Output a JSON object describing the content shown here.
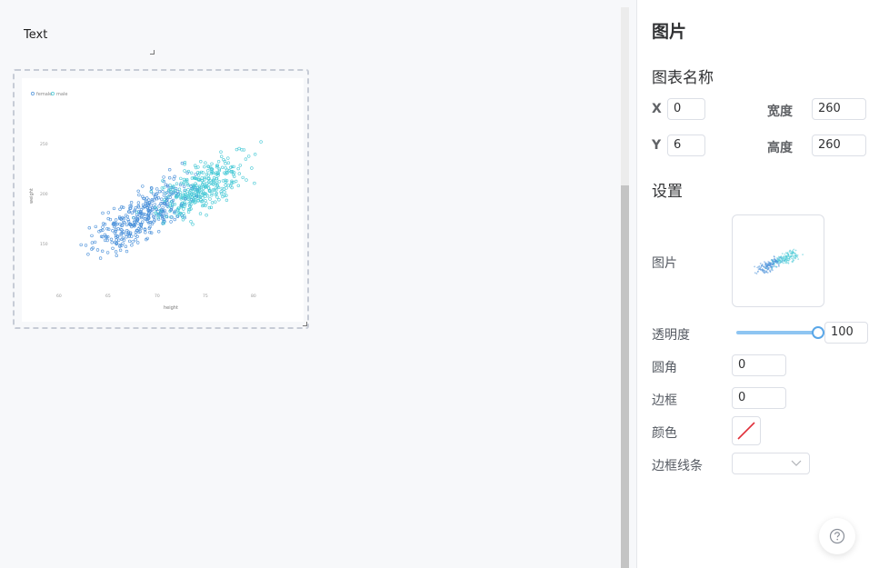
{
  "canvas": {
    "text_widget": "Text",
    "image_widget": {
      "legend": [
        "female",
        "male"
      ],
      "x_ticks": [
        "60",
        "65",
        "70",
        "75",
        "80"
      ],
      "y_ticks": [
        "150",
        "200",
        "250"
      ],
      "xlabel": "height",
      "ylabel": "weight"
    }
  },
  "panel": {
    "title": "图片",
    "section_chart_name": "图表名称",
    "x_label": "X",
    "x_value": "0",
    "width_label": "宽度",
    "width_value": "260",
    "y_label": "Y",
    "y_value": "6",
    "height_label": "高度",
    "height_value": "260",
    "section_settings": "设置",
    "image_label": "图片",
    "opacity_label": "透明度",
    "opacity_value": "100",
    "radius_label": "圆角",
    "radius_value": "0",
    "border_label": "边框",
    "border_value": "0",
    "color_label": "颜色",
    "border_style_label": "边框线条"
  },
  "colors": {
    "female": "#4a90d9",
    "male": "#48c9d6",
    "accent": "#5aa7e8",
    "swatch_slash": "#e0303a"
  }
}
